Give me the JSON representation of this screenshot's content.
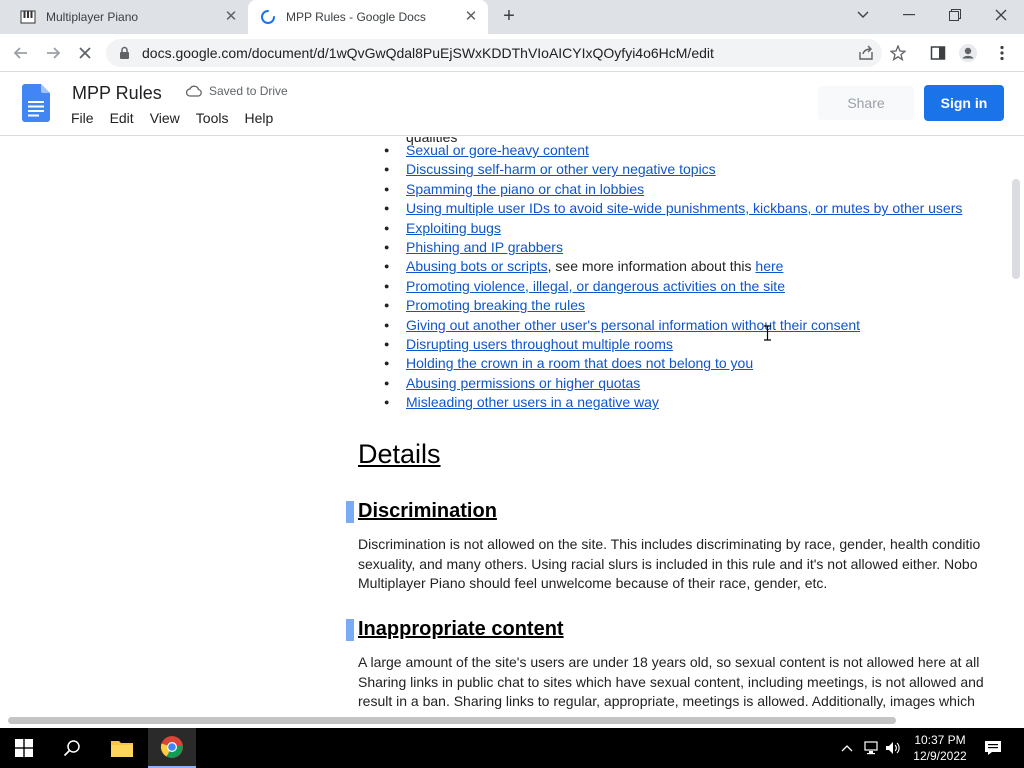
{
  "browser": {
    "tabs": [
      {
        "title": "Multiplayer Piano",
        "active": false
      },
      {
        "title": "MPP Rules - Google Docs",
        "active": true
      }
    ],
    "url": "docs.google.com/document/d/1wQvGwQdal8PuEjSWxKDDThVIoAICYIxQOyfyi4o6HcM/edit"
  },
  "docs": {
    "title": "MPP Rules",
    "saved_status": "Saved to Drive",
    "menu": [
      "File",
      "Edit",
      "View",
      "Tools",
      "Help"
    ],
    "share_label": "Share",
    "signin_label": "Sign in"
  },
  "document": {
    "partial_line": "qualities",
    "rules": [
      "Sexual or gore-heavy content",
      "Discussing self-harm or other very negative topics",
      "Spamming the piano or chat in lobbies",
      "Using multiple user IDs to avoid site-wide punishments, kickbans, or mutes by other users",
      "Exploiting bugs",
      "Phishing and IP grabbers",
      "Abusing bots or scripts",
      "Promoting violence, illegal, or dangerous activities on the site",
      "Promoting breaking the rules",
      "Giving out another other user's personal information without their consent",
      "Disrupting users throughout multiple rooms",
      "Holding the crown in a room that does not belong to you",
      "Abusing permissions or higher quotas",
      "Misleading other users in a negative way"
    ],
    "bots_suffix": ", see more information about this ",
    "bots_link": "here",
    "details_heading": "Details",
    "discrimination": {
      "heading": "Discrimination",
      "lines": [
        "Discrimination is not allowed on the site. This includes discriminating by race, gender, health conditio",
        "sexuality, and many others. Using racial slurs is included in this rule and it's not  allowed either. Nobo",
        "Multiplayer Piano should feel unwelcome because of their race, gender, etc."
      ]
    },
    "inappropriate": {
      "heading": "Inappropriate content",
      "lines": [
        "A large amount of the site's users are under 18 years old, so sexual content is not allowed here at all",
        "Sharing links in public chat to sites which have sexual content, including meetings, is not allowed and",
        "result in a ban. Sharing links to regular, appropriate, meetings is allowed. Additionally, images which"
      ]
    }
  },
  "taskbar": {
    "time": "10:37 PM",
    "date": "12/9/2022"
  }
}
